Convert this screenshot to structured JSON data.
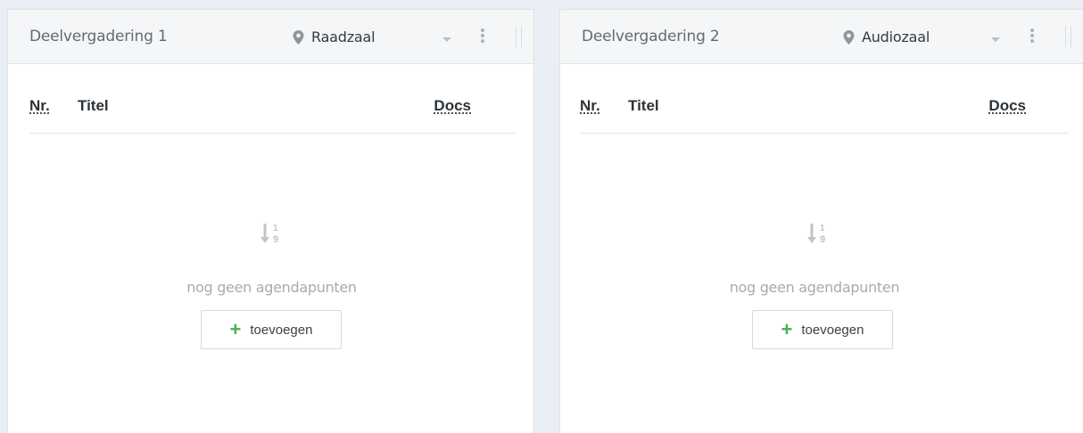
{
  "panels": [
    {
      "title": "Deelvergadering 1",
      "location": "Raadzaal",
      "columns": {
        "nr": "Nr.",
        "titel": "Titel",
        "docs": "Docs"
      },
      "empty_text": "nog geen agendapunten",
      "add_label": "toevoegen"
    },
    {
      "title": "Deelvergadering 2",
      "location": "Audiozaal",
      "columns": {
        "nr": "Nr.",
        "titel": "Titel",
        "docs": "Docs"
      },
      "empty_text": "nog geen agendapunten",
      "add_label": "toevoegen"
    }
  ],
  "icons": {
    "location": "map-pin-icon",
    "dropdown": "caret-down-icon",
    "menu": "kebab-menu-icon",
    "drag": "drag-handle-icon",
    "empty": "sort-numeric-icon",
    "add": "plus-icon"
  },
  "colors": {
    "accent_green": "#4caf50",
    "muted_text": "#a4acb3",
    "header_bg": "#f5f6f7"
  }
}
